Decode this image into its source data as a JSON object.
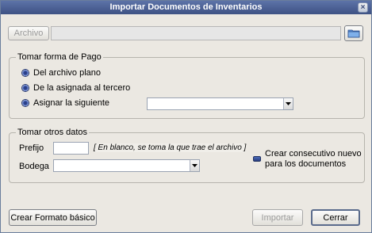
{
  "window": {
    "title": "Importar Documentos de Inventarios",
    "close_glyph": "×"
  },
  "archivo": {
    "button_label": "Archivo",
    "value": ""
  },
  "forma_pago": {
    "legend": "Tomar forma de Pago",
    "options": [
      "Del archivo plano",
      "De la asignada al tercero",
      "Asignar la siguiente"
    ],
    "select_value": ""
  },
  "otros_datos": {
    "legend": "Tomar otros datos",
    "prefijo_label": "Prefijo",
    "prefijo_value": "",
    "prefijo_note": "[ En blanco, se toma la que trae el archivo ]",
    "bodega_label": "Bodega",
    "bodega_value": "",
    "consecutivo_label_1": "Crear consecutivo nuevo",
    "consecutivo_label_2": "para los documentos"
  },
  "footer": {
    "crear_formato_label": "Crear Formato básico",
    "importar_label": "Importar",
    "cerrar_label": "Cerrar"
  },
  "colors": {
    "title_bar": "#4a5f92",
    "window_bg": "#ebe8e2",
    "radio": "#2b3f86"
  }
}
